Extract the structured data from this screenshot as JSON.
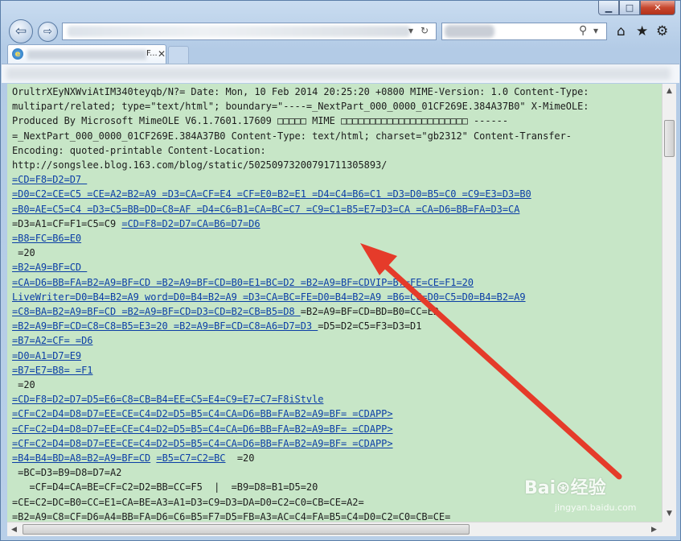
{
  "window": {
    "caption": {
      "minimize": "▁",
      "maximize": "□",
      "close": "✕"
    }
  },
  "nav": {
    "back_icon": "arrow-left-icon",
    "forward_icon": "arrow-right-icon",
    "address_value": "",
    "refresh_icon": "↻",
    "stop_icon": "✕",
    "search_placeholder": "",
    "search_icon": "⚲",
    "home_icon": "⌂",
    "favorites_icon": "★",
    "tools_icon": "⚙"
  },
  "tab": {
    "title_suffix": "F...",
    "close_icon": "✕",
    "favicon": "e"
  },
  "content": {
    "lines": [
      [
        {
          "t": "OrultrXEyNXWviAtIM340teyqb/N?= Date: Mon, 10 Feb 2014 20:25:20 +0800 MIME-Version: 1.0 Content-Type:"
        }
      ],
      [
        {
          "t": "multipart/related; type=\"text/html\"; boundary=\"----=_NextPart_000_0000_01CF269E.384A37B0\" X-MimeOLE:"
        }
      ],
      [
        {
          "t": "Produced By Microsoft MimeOLE V6.1.7601.17609 □□□□□ MIME □□□□□□□□□□□□□□□□□□□□□□ ------"
        }
      ],
      [
        {
          "t": "=_NextPart_000_0000_01CF269E.384A37B0 Content-Type: text/html; charset=\"gb2312\" Content-Transfer-"
        }
      ],
      [
        {
          "t": "Encoding: quoted-printable Content-Location:"
        }
      ],
      [
        {
          "t": "http://songslee.blog.163.com/blog/static/5025097320079171130589​3/"
        }
      ],
      [
        {
          "t": "=CD=F8=D2=D7 ",
          "l": 1
        }
      ],
      [
        {
          "t": "=D0=C2=CE=C5 =CE=A2=B2=A9 =D3=CA=CF=E4 =CF=E0=B2=E1 =D4=C4=B6=C1 =D3=D0=B5=C0 =C9=E3=D3=B0",
          "l": 1
        }
      ],
      [
        {
          "t": "=B0=AE=C5=C4 =D3=C5=BB=DD=C8=AF =D4=C6=B1=CA=BC=C7 =C9=C1=B5=E7=D3=CA =CA=D6=BB=FA=D3=CA",
          "l": 1
        }
      ],
      [
        {
          "t": "=D3=A1=CF=F1=C5=C9 "
        },
        {
          "t": "=CD=F8=D2=D7=CA=B6=D7=D6",
          "l": 1
        }
      ],
      [
        {
          "t": "=B8=FC=B6=E0",
          "l": 1
        }
      ],
      [
        {
          "t": " =20"
        }
      ],
      [
        {
          "t": "=B2=A9=BF=CD ",
          "l": 1
        }
      ],
      [
        {
          "t": "=CA=D6=BB=FA=B2=A9=BF=CD =B2=A9=BF=CD=B0=E1=BC=D2 =B2=A9=BF=CDVIP=B7=FE=CE=F1=20",
          "l": 1
        }
      ],
      [
        {
          "t": "LiveWriter=D0=B4=B2=A9 word=D0=B4=B2=A9 =D3=CA=BC=FE=D0=B4=B2=A9 =B6=CC=D0=C5=D0=B4=B2=A9",
          "l": 1
        }
      ],
      [
        {
          "t": "=C8=BA=B2=A9=BF=CD =B2=A9=BF=CD=D3=CD=B2=CB=B5=D8 ",
          "l": 1
        },
        {
          "t": "=B2=A9=BF=CD=BD=B0=CC=E2"
        }
      ],
      [
        {
          "t": "=B2=A9=BF=CD=C8=C8=B5=E3=20 =B2=A9=BF=CD=C8=A6=D7=D3 ",
          "l": 1
        },
        {
          "t": "=D5=D2=C5=F3=D3=D1"
        }
      ],
      [
        {
          "t": "=B7=A2=CF= =D6",
          "l": 1
        }
      ],
      [
        {
          "t": "=D0=A1=D7=E9",
          "l": 1
        }
      ],
      [
        {
          "t": "=B7=E7=B8= =F1",
          "l": 1
        }
      ],
      [
        {
          "t": " =20"
        }
      ],
      [
        {
          "t": "=CD=F8=D2=D7=D5=E6=C8=CB=B4=EE=C5=E4=C9=E7=C7=F8iStvle",
          "l": 1
        }
      ],
      [
        {
          "t": "=CF=C2=D4=D8=D7=EE=CE=C4=D2=D5=B5=C4=CA=D6=BB=FA=B2=A9=BF= =CDAPP>",
          "l": 1
        }
      ],
      [
        {
          "t": "=CF=C2=D4=D8=D7=EE=CE=C4=D2=D5=B5=C4=CA=D6=BB=FA=B2=A9=BF= =CDAPP>",
          "l": 1
        }
      ],
      [
        {
          "t": "=CF=C2=D4=D8=D7=EE=CE=C4=D2=D5=B5=C4=CA=D6=BB=FA=B2=A9=BF= =CDAPP>",
          "l": 1
        }
      ],
      [
        {
          "t": "=B4=B4=BD=A8=B2=A9=BF=CD",
          "l": 1
        },
        {
          "t": " "
        },
        {
          "t": "=B5=C7=C2=BC",
          "l": 1
        },
        {
          "t": "  =20"
        }
      ],
      [
        {
          "t": " =BC=D3=B9=D8=D7=A2"
        }
      ],
      [
        {
          "t": "   =CF=D4=CA=BE=CF=C2=D2=BB=CC=F5  |  =B9=D8=B1=D5=20"
        }
      ],
      [
        {
          "t": "=CE=C2=DC=B0=CC=E1=CA=BE=A3=A1=D3=C9=D3=DA=D0=C2=C0=CB=CE=A2="
        }
      ],
      [
        {
          "t": "=B2=A9=C8=CF=D6=A4=BB=FA=D6=C6=B5=F7=D5=FB=A3=AC=C4=FA=B5=C4=D0=C2=C0=CB=CE="
        }
      ]
    ]
  },
  "watermark": {
    "logo": "Bai⊛经验",
    "url": "jingyan.baidu.com"
  },
  "colors": {
    "content_bg": "#c7e6c7",
    "link": "#0b3ea6",
    "arrow": "#e53b2a"
  }
}
